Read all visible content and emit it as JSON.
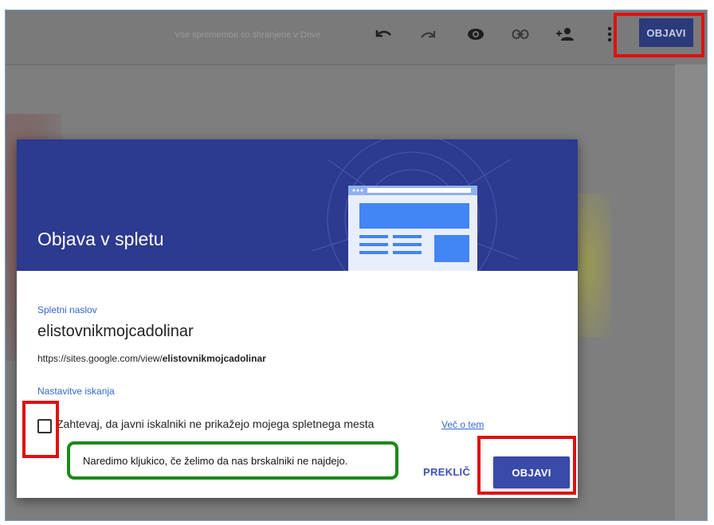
{
  "toolbar": {
    "saved_status": "Vse spremembe so shranjene v Drive",
    "publish_label": "OBJAVI",
    "icons": [
      "undo-icon",
      "redo-icon",
      "preview-icon",
      "link-icon",
      "add-person-icon",
      "more-vert-icon"
    ]
  },
  "dialog": {
    "title": "Objava v spletu",
    "address_label": "Spletni naslov",
    "site_name": "elistovnikmojcadolinar",
    "url_prefix": "https://sites.google.com/view/",
    "url_name": "elistovnikmojcadolinar",
    "search_label": "Nastavitve iskanja",
    "checkbox_label": "Zahtevaj, da javni iskalniki ne prikažejo mojega spletnega mesta",
    "checkbox_checked": false,
    "more_link": "Več o tem",
    "cancel_label": "PREKLIČ",
    "publish_label": "OBJAVI"
  },
  "annotation": {
    "callout_text": "Naredimo kljukico, če želimo da nas brskalniki ne najdejo."
  },
  "colors": {
    "hero": "#2c3a8f",
    "primary": "#3a4aa8",
    "link": "#3367d6",
    "highlight_red": "#e01010",
    "callout_green": "#1a8a1a"
  }
}
